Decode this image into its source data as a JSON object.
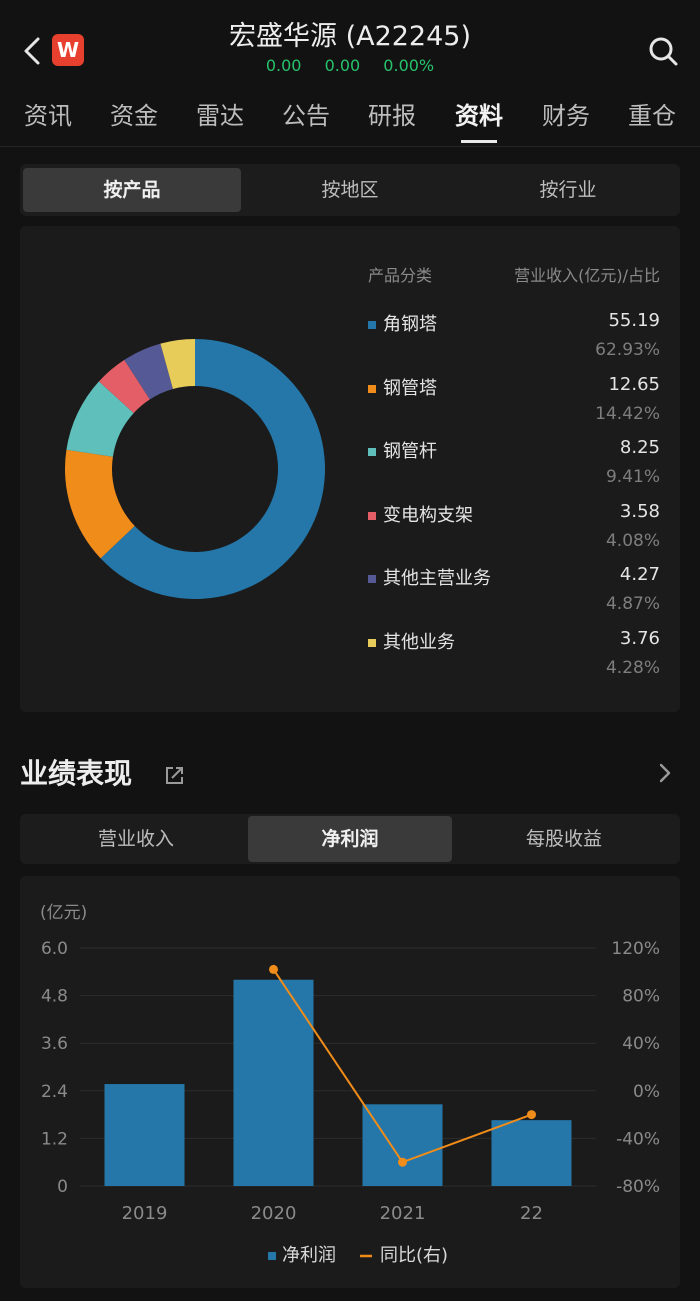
{
  "header": {
    "title": "宏盛华源 (A22245)",
    "price": "0.00",
    "change": "0.00",
    "change_pct": "0.00%",
    "logo_text": "W",
    "quote_color": "#27c26b"
  },
  "tabs": [
    {
      "label": "资讯"
    },
    {
      "label": "资金"
    },
    {
      "label": "雷达"
    },
    {
      "label": "公告"
    },
    {
      "label": "研报"
    },
    {
      "label": "资料",
      "active": true
    },
    {
      "label": "财务"
    },
    {
      "label": "重仓"
    }
  ],
  "segment": {
    "items": [
      "按产品",
      "按地区",
      "按行业"
    ],
    "active": 0
  },
  "revenue": {
    "col_category": "产品分类",
    "col_value": "营业收入(亿元)/占比",
    "items": [
      {
        "name": "角钢塔",
        "value": "55.19",
        "pct": "62.93%",
        "share": 62.93,
        "color": "#2477a8"
      },
      {
        "name": "钢管塔",
        "value": "12.65",
        "pct": "14.42%",
        "share": 14.42,
        "color": "#f08c1a"
      },
      {
        "name": "钢管杆",
        "value": "8.25",
        "pct": "9.41%",
        "share": 9.41,
        "color": "#5fc0bb"
      },
      {
        "name": "变电构支架",
        "value": "3.58",
        "pct": "4.08%",
        "share": 4.08,
        "color": "#e35e66"
      },
      {
        "name": "其他主营业务",
        "value": "4.27",
        "pct": "4.87%",
        "share": 4.87,
        "color": "#555a96"
      },
      {
        "name": "其他业务",
        "value": "3.76",
        "pct": "4.28%",
        "share": 4.28,
        "color": "#e8cc5a"
      }
    ]
  },
  "performance": {
    "title": "业绩表现",
    "tabs": [
      "营业收入",
      "净利润",
      "每股收益"
    ],
    "active_tab": 1
  },
  "chart_data": {
    "type": "bar",
    "categories": [
      "2019",
      "2020",
      "2021",
      "22"
    ],
    "series": [
      {
        "name": "净利润",
        "type": "bar",
        "values": [
          2.57,
          5.2,
          2.06,
          1.66
        ],
        "color": "#2477a8",
        "axis": "left"
      },
      {
        "name": "同比(右)",
        "type": "line",
        "values": [
          null,
          102,
          -60,
          -20
        ],
        "color": "#f08c1a",
        "axis": "right"
      }
    ],
    "ylabel": "(亿元)",
    "yticks_left": [
      "6.0",
      "4.8",
      "3.6",
      "2.4",
      "1.2",
      "0"
    ],
    "yticks_right": [
      "120%",
      "80%",
      "40%",
      "0%",
      "-40%",
      "-80%"
    ],
    "ylim_left": [
      0,
      6
    ],
    "ylim_right": [
      -80,
      120
    ],
    "grid": true,
    "legend_position": "bottom"
  }
}
